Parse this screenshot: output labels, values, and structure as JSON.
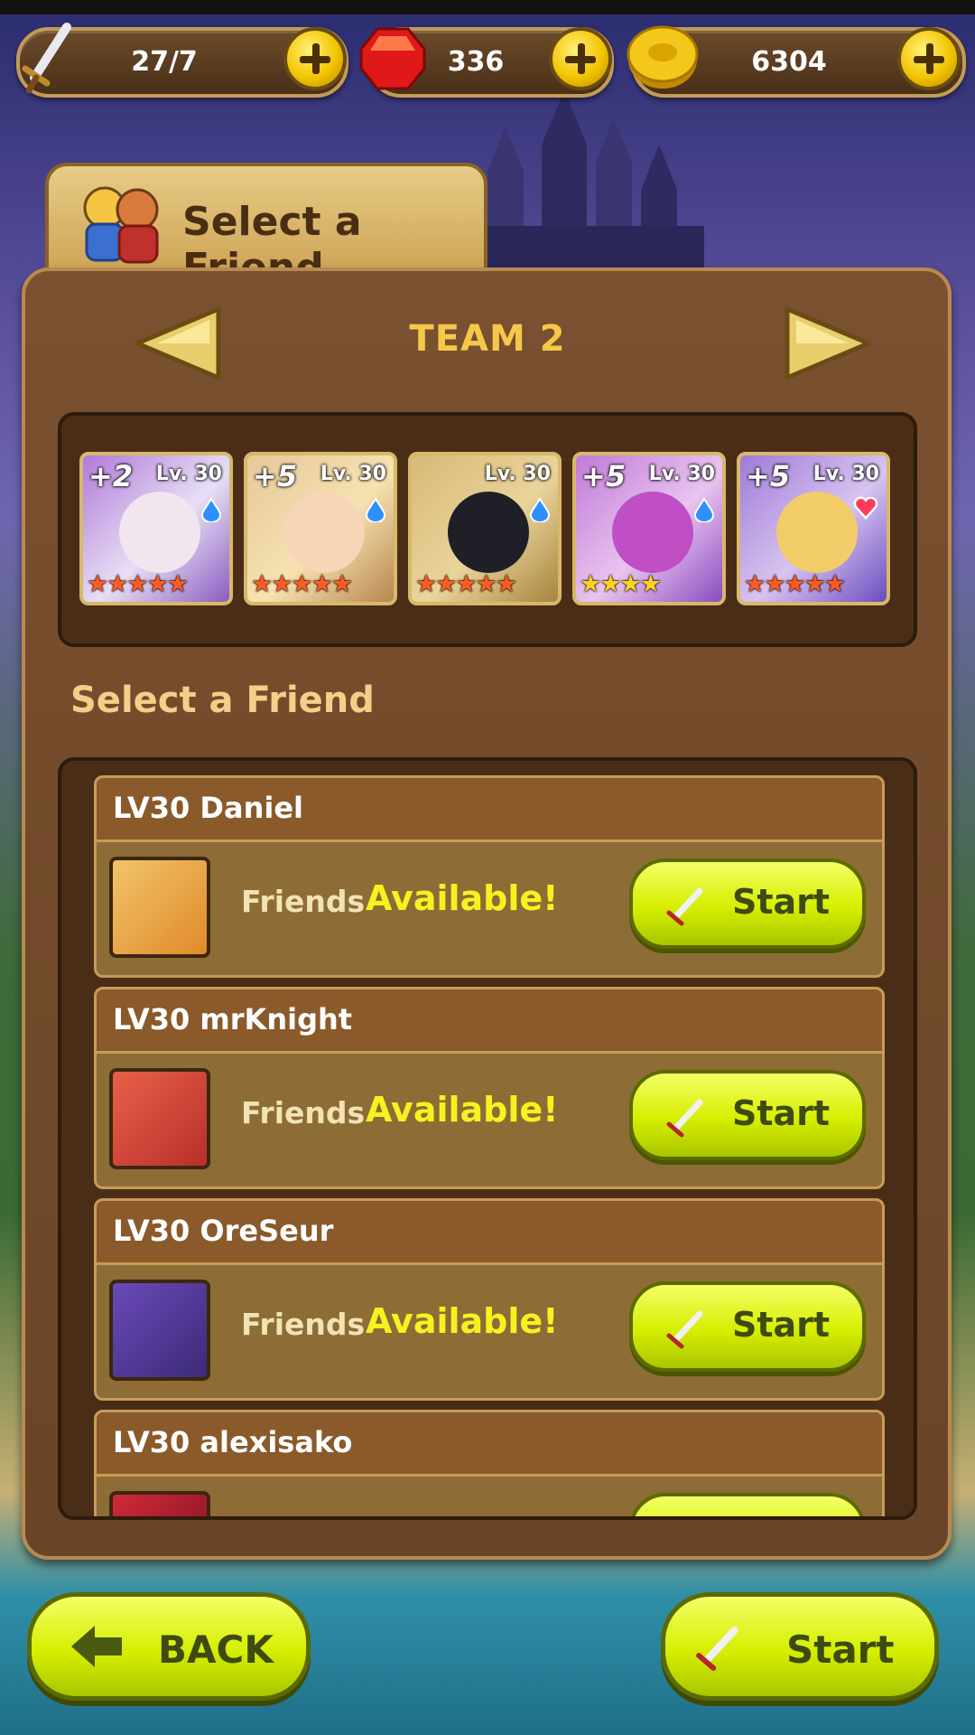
{
  "resources": {
    "stamina": "27/7",
    "gems": "336",
    "gold": "6304"
  },
  "panel": {
    "tab_title": "Select a Friend",
    "team_title": "TEAM 2",
    "friend_heading": "Select a Friend"
  },
  "team": [
    {
      "plus": "+2",
      "level": "Lv. 30",
      "stars": "★★★★★",
      "element": "water-icon"
    },
    {
      "plus": "+5",
      "level": "Lv. 30",
      "stars": "★★★★★",
      "element": "water-icon"
    },
    {
      "plus": "",
      "level": "Lv. 30",
      "stars": "★★★★★",
      "element": "water-icon"
    },
    {
      "plus": "+5",
      "level": "Lv. 30",
      "stars": "★★★★",
      "element": "water-icon"
    },
    {
      "plus": "+5",
      "level": "Lv. 30",
      "stars": "★★★★★",
      "element": "heart-icon"
    }
  ],
  "friends": [
    {
      "name": "LV30 Daniel",
      "relation": "Friends",
      "status": "Available!",
      "button": "Start"
    },
    {
      "name": "LV30 mrKnight",
      "relation": "Friends",
      "status": "Available!",
      "button": "Start"
    },
    {
      "name": "LV30 OreSeur",
      "relation": "Friends",
      "status": "Available!",
      "button": "Start"
    },
    {
      "name": "LV30 alexisako",
      "relation": "",
      "status": "",
      "button": ""
    }
  ],
  "footer": {
    "back_label": "BACK",
    "start_label": "Start"
  },
  "colors": {
    "accent_yellow": "#d6ee00",
    "panel_brown": "#6a4426",
    "title_gold": "#f6c84a"
  }
}
